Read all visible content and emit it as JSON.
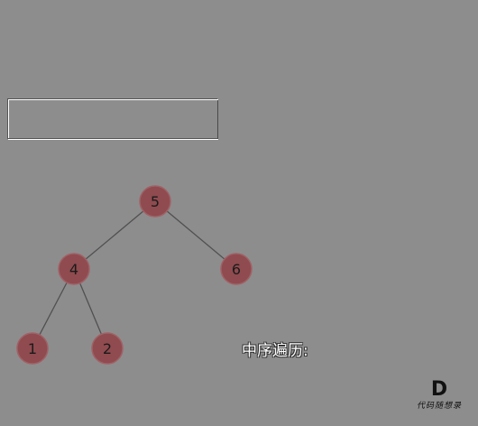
{
  "tree": {
    "nodes": [
      {
        "id": "n5",
        "label": "5"
      },
      {
        "id": "n4",
        "label": "4"
      },
      {
        "id": "n6",
        "label": "6"
      },
      {
        "id": "n1",
        "label": "1"
      },
      {
        "id": "n2",
        "label": "2"
      }
    ],
    "edges": [
      [
        "n5",
        "n4"
      ],
      [
        "n5",
        "n6"
      ],
      [
        "n4",
        "n1"
      ],
      [
        "n4",
        "n2"
      ]
    ],
    "node_fill": "#8f4b4f",
    "node_stroke": "#a06166",
    "edge_color": "#505050"
  },
  "traversal": {
    "label": "中序遍历:"
  },
  "watermark": {
    "mark": "D",
    "text": "代码随想录"
  }
}
